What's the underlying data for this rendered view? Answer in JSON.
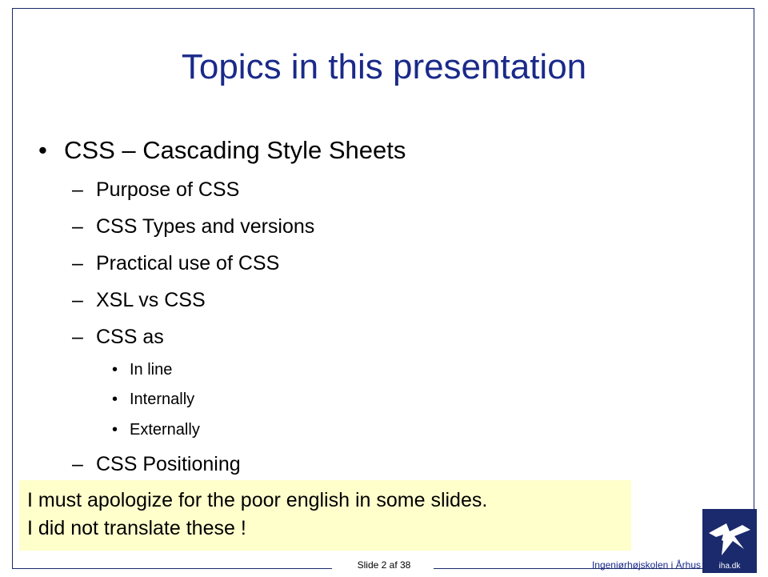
{
  "slide": {
    "title": "Topics in this presentation",
    "bullets": [
      {
        "text": "CSS – Cascading Style Sheets"
      }
    ],
    "subitems": [
      {
        "text": "Purpose of CSS"
      },
      {
        "text": "CSS Types and versions"
      },
      {
        "text": "Practical use of CSS"
      },
      {
        "text": "XSL vs CSS"
      },
      {
        "text": "CSS as"
      },
      {
        "text": "CSS Positioning"
      }
    ],
    "subsubitems": [
      {
        "text": "In line"
      },
      {
        "text": "Internally"
      },
      {
        "text": "Externally"
      }
    ],
    "bullet_char": "•",
    "dash_char": "–"
  },
  "note": {
    "line1": "I must apologize for the poor english in some slides.",
    "line2": "I did not translate these !"
  },
  "footer": {
    "slide_number": "Slide 2 af 38",
    "school": "Ingeniørhøjskolen i Århus",
    "logo_text": "iha.dk"
  },
  "colors": {
    "title": "#1a2a8a",
    "note_background": "#ffffcc",
    "logo": "#1a2a6c"
  }
}
